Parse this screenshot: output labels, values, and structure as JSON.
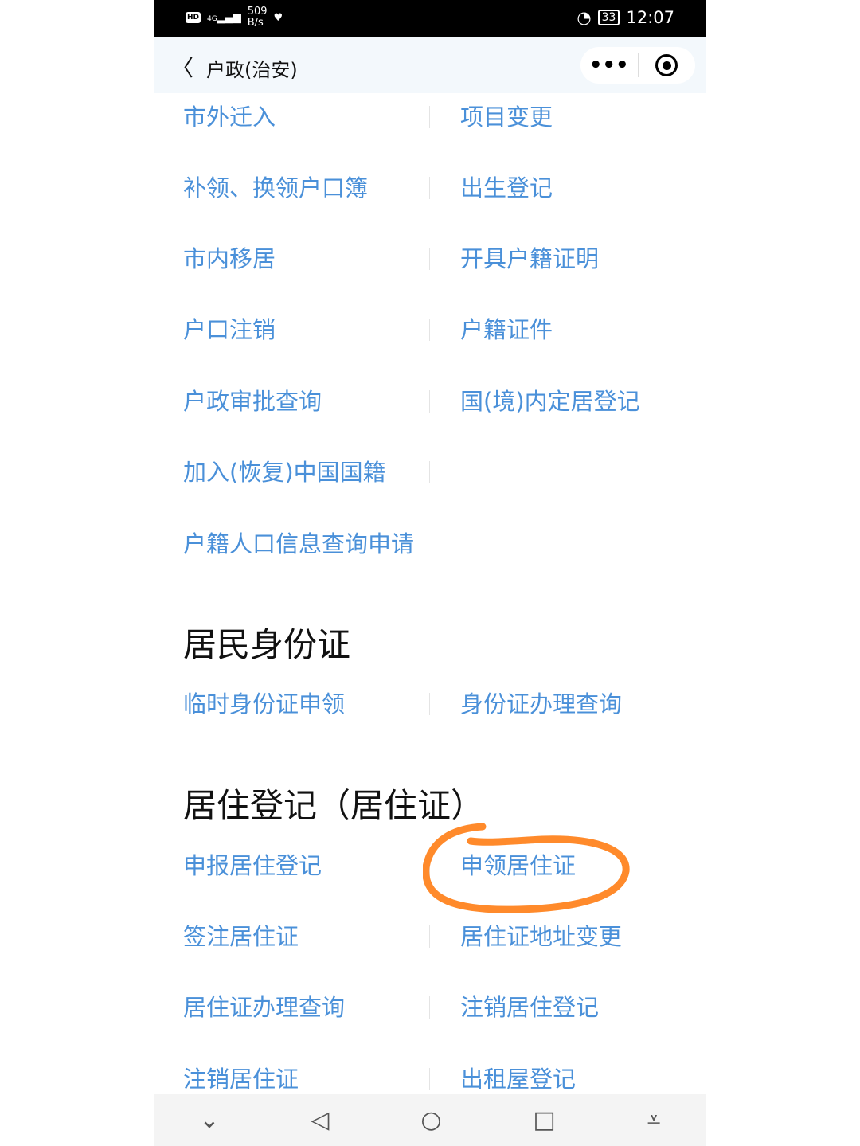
{
  "status": {
    "network": "4G",
    "speed_value": "509",
    "speed_unit": "B/s",
    "battery": "33",
    "time": "12:07"
  },
  "nav": {
    "title": "户政(治安)",
    "more_label": "•••"
  },
  "group1": [
    [
      "市外迁入",
      "项目变更"
    ],
    [
      "补领、换领户口簿",
      "出生登记"
    ],
    [
      "市内移居",
      "开具户籍证明"
    ],
    [
      "户口注销",
      "户籍证件"
    ],
    [
      "户政审批查询",
      "国(境)内定居登记"
    ],
    [
      "加入(恢复)中国国籍",
      ""
    ],
    [
      "户籍人口信息查询申请",
      null
    ]
  ],
  "section2": {
    "title": "居民身份证",
    "items": [
      [
        "临时身份证申领",
        "身份证办理查询"
      ]
    ]
  },
  "section3": {
    "title": "居住登记（居住证）",
    "items": [
      [
        "申报居住登记",
        "申领居住证"
      ],
      [
        "签注居住证",
        "居住证地址变更"
      ],
      [
        "居住证办理查询",
        "注销居住登记"
      ],
      [
        "注销居住证",
        "出租屋登记"
      ]
    ]
  },
  "annotation": {
    "color": "#ff8a2b",
    "circled_item": "申领居住证"
  },
  "colors": {
    "link": "#4a90d9"
  }
}
